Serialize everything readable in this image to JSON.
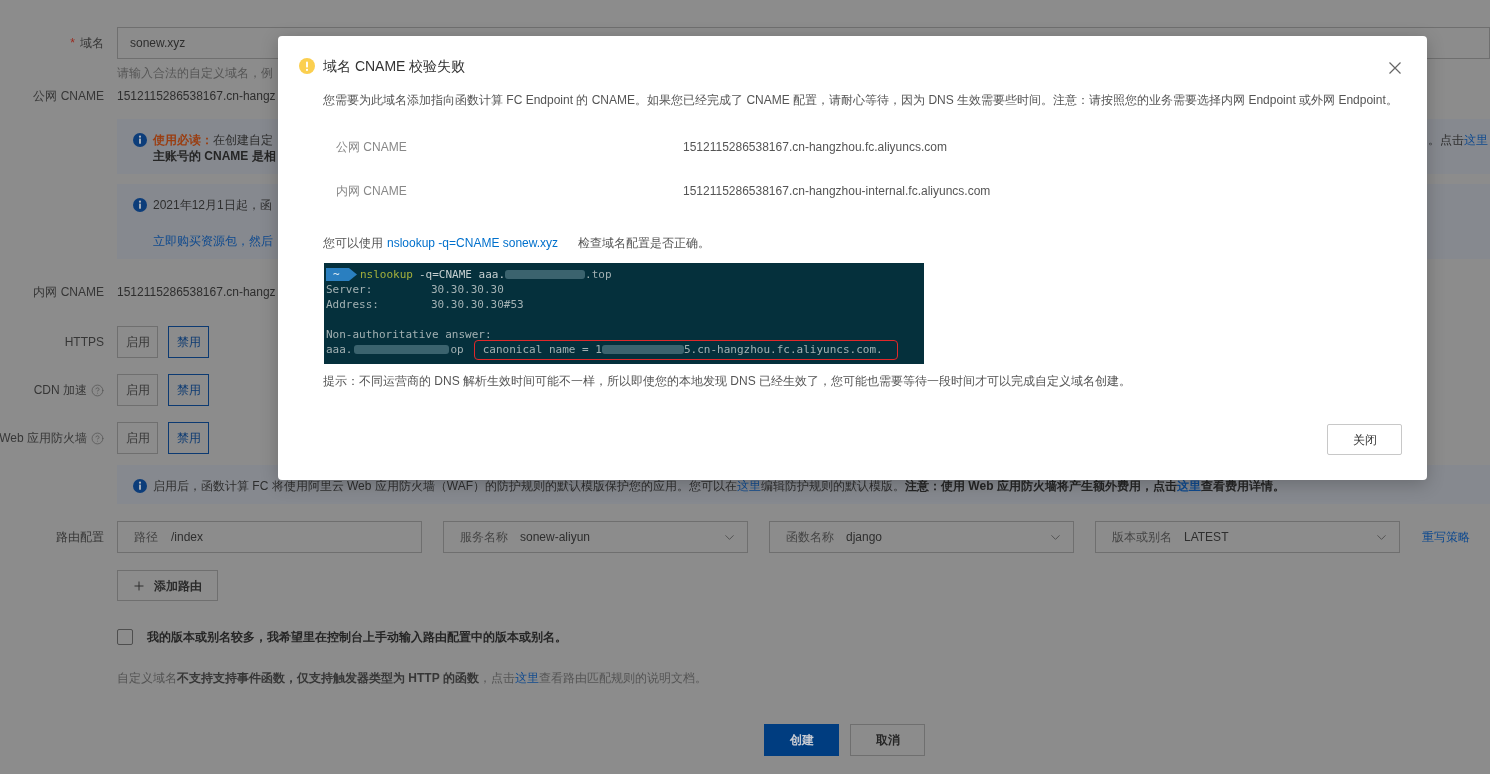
{
  "form": {
    "domain": {
      "required_mark": "*",
      "label": "域名",
      "value": "sonew.xyz",
      "hint": "请输入合法的自定义域名，例"
    },
    "public_cname": {
      "label": "公网 CNAME",
      "value": "1512115286538167.cn-hangz"
    },
    "notices": [
      {
        "paragraphs": [
          [
            [
              {
                "kind": "lead",
                "text": "使用必读："
              },
              {
                "kind": "text",
                "text": "在创建自定"
              }
            ],
            [
              {
                "kind": "bold",
                "text": "主账号的 CNAME 是相"
              }
            ]
          ]
        ],
        "right": [
          {
            "kind": "text",
            "text": "。点击"
          },
          {
            "kind": "link",
            "text": "这里"
          }
        ]
      },
      {
        "paragraphs": [
          [
            [
              {
                "kind": "text",
                "text": "2021年12月1日起，函"
              }
            ]
          ],
          [
            [
              {
                "kind": "link",
                "text": "立即购买资源包，然后"
              }
            ]
          ]
        ]
      }
    ],
    "internal_cname": {
      "label": "内网 CNAME",
      "value": "1512115286538167.cn-hangz"
    },
    "toggles": [
      {
        "label": "HTTPS",
        "help": false,
        "options": [
          {
            "label": "启用",
            "selected": false
          },
          {
            "label": "禁用",
            "selected": true
          }
        ]
      },
      {
        "label": "CDN 加速",
        "help": true,
        "options": [
          {
            "label": "启用",
            "selected": false
          },
          {
            "label": "禁用",
            "selected": true
          }
        ]
      },
      {
        "label": "Web 应用防火墙",
        "help": true,
        "options": [
          {
            "label": "启用",
            "selected": false
          },
          {
            "label": "禁用",
            "selected": true
          }
        ]
      }
    ],
    "waf_notice": {
      "paragraphs": [
        [
          [
            {
              "kind": "text",
              "text": "启用后，函数计算 FC 将使用阿里云 Web 应用防火墙（WAF）的防护规则的默认模版保护您的应用。您可以在"
            },
            {
              "kind": "link",
              "text": "这里"
            },
            {
              "kind": "text",
              "text": "编辑防护规则的默认模版。"
            },
            {
              "kind": "bold",
              "text": "注意：使用 Web 应用防火墙将产生额外费用，点击"
            },
            {
              "kind": "bold_link",
              "text": "这里"
            },
            {
              "kind": "bold",
              "text": "查看费用详情。"
            }
          ]
        ]
      ]
    },
    "route": {
      "label": "路由配置",
      "fields": [
        {
          "kind": "input",
          "label": "路径",
          "value": "/index"
        },
        {
          "kind": "select",
          "label": "服务名称",
          "value": "sonew-aliyun"
        },
        {
          "kind": "select",
          "label": "函数名称",
          "value": "django"
        },
        {
          "kind": "select",
          "label": "版本或别名",
          "value": "LATEST"
        }
      ],
      "link": "重写策略",
      "add_button": "添加路由"
    },
    "manual_version": {
      "label": "我的版本或别名较多，我希望里在控制台上手动输入路由配置中的版本或别名。",
      "checked": false
    },
    "note": {
      "before": "自定义域名**不支持支持事件函数，仅支持触发器类型为 HTTP 的函数**，点击",
      "link": "这里",
      "after": "查看路由匹配规则的说明文档。"
    },
    "buttons": [
      {
        "kind": "primary",
        "label": "创建"
      },
      {
        "kind": "secondary",
        "label": "取消"
      }
    ]
  },
  "dialog": {
    "title": "域名 CNAME 校验失败",
    "description": "您需要为此域名添加指向函数计算 FC Endpoint 的 CNAME。如果您已经完成了 CNAME 配置，请耐心等待，因为 DNS 生效需要些时间。注意：请按照您的业务需要选择内网 Endpoint 或外网 Endpoint。",
    "cname_rows": [
      {
        "label": "公网 CNAME",
        "value": "1512115286538167.cn-hangzhou.fc.aliyuncs.com"
      },
      {
        "label": "内网 CNAME",
        "value": "1512115286538167.cn-hangzhou-internal.fc.aliyuncs.com"
      }
    ],
    "check_hint": {
      "before": "您可以使用",
      "command": "nslookup -q=CNAME sonew.xyz",
      "after": "检查域名配置是否正确。"
    },
    "terminal": {
      "lines": [
        {
          "kind": "prompt",
          "prompt": "~",
          "command": "nslookup",
          "args": "-q=CNAME aaa.",
          "tail": ".top"
        },
        {
          "kind": "pair",
          "label": "Server:",
          "value": "30.30.30.30"
        },
        {
          "kind": "pair",
          "label": "Address:",
          "value": "30.30.30.30#53"
        },
        {
          "kind": "blank"
        },
        {
          "kind": "plain",
          "text": "Non-authoritative answer:"
        },
        {
          "kind": "answer",
          "host": "aaa.",
          "host_tail": "op",
          "answer": "canonical name = 1",
          "answer_tail": "5.cn-hangzhou.fc.aliyuncs.com."
        }
      ]
    },
    "tip": "提示：不同运营商的 DNS 解析生效时间可能不一样，所以即使您的本地发现 DNS 已经生效了，您可能也需要等待一段时间才可以完成自定义域名创建。",
    "buttons": [
      "关闭"
    ]
  }
}
